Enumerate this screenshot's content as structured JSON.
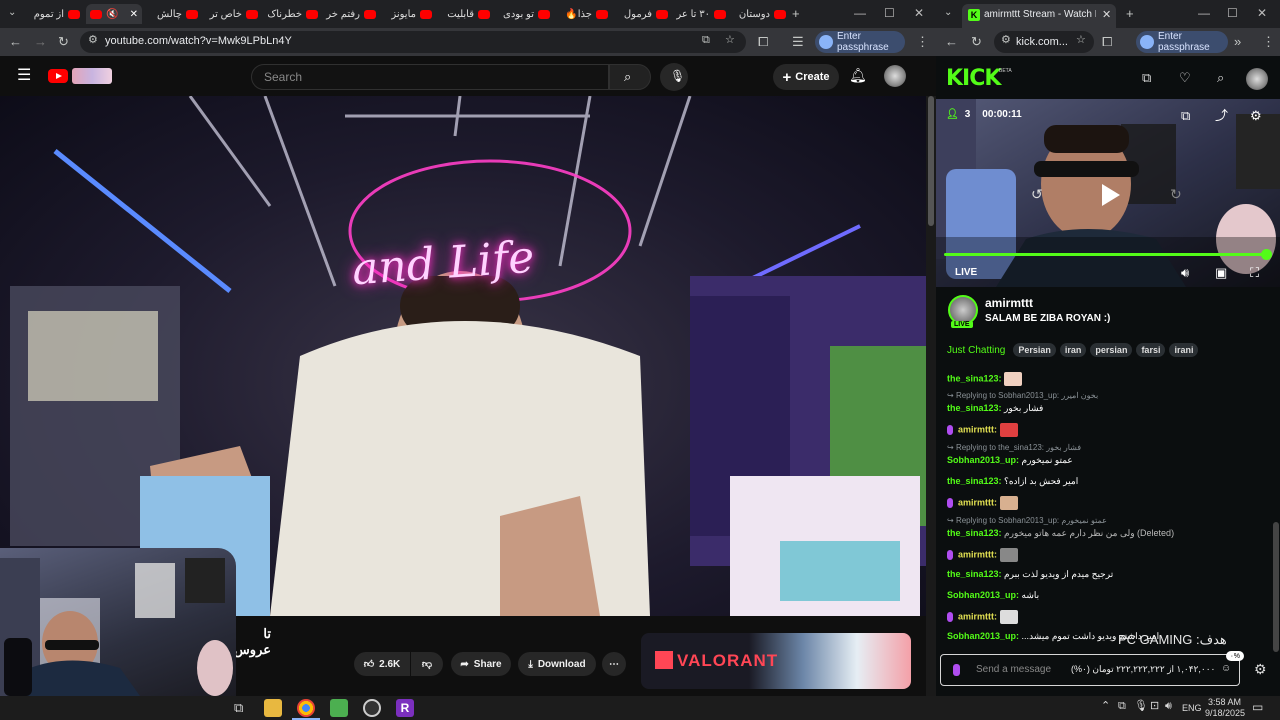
{
  "left_browser": {
    "tabs": [
      "دوستان",
      "۳۰ تا عر",
      "فرمول",
      "جذا🔥",
      "تو بودی",
      "قابلیت",
      "مایونز",
      "رفتم خر",
      "خطرناک",
      "خاص تر",
      "چالش",
      "",
      "از تموم"
    ],
    "url": "youtube.com/watch?v=Mwk9LPbLn4Y",
    "passphrase_label": "Enter passphrase"
  },
  "youtube": {
    "search_placeholder": "Search",
    "create_label": "Create",
    "video_title": "تا عروس",
    "like_count": "2.6K",
    "share_label": "Share",
    "download_label": "Download",
    "ad_brand": "VALORANT"
  },
  "video_overlay": {
    "neon_sign": "and Life"
  },
  "right_browser": {
    "tab_title": "amirmttt Stream - Watch Live o",
    "url": "kick.com...",
    "passphrase_label": "Enter passphrase"
  },
  "kick": {
    "logo": "KICK",
    "logo_badge": "BETA",
    "viewers": "3",
    "uptime": "00:00:11",
    "live_label": "LIVE",
    "streamer": "amirmttt",
    "stream_title": "SALAM BE ZIBA ROYAN :)",
    "category": "Just Chatting",
    "tags": [
      "Persian",
      "iran",
      "persian",
      "farsi",
      "irani"
    ],
    "chat": [
      {
        "user": "the_sina123",
        "text": ""
      },
      {
        "reply": "Replying to Sobhan2013_up: بخون امیرر"
      },
      {
        "user": "the_sina123",
        "text": "فشار بخور"
      },
      {
        "user": "amirmttt",
        "text": ""
      },
      {
        "reply": "Replying to the_sina123: فشار بخور"
      },
      {
        "user": "Sobhan2013_up",
        "text": "عمتو نمیخورم"
      },
      {
        "user": "the_sina123",
        "text": "امیر فحش بد ازاده؟"
      },
      {
        "user": "amirmttt",
        "text": ""
      },
      {
        "reply": "Replying to Sobhan2013_up: عمتو نمیخورم"
      },
      {
        "user": "the_sina123",
        "text": "ولی من نظر دارم عمه هاتو میخورم (Deleted)"
      },
      {
        "user": "amirmttt",
        "text": ""
      },
      {
        "user": "the_sina123",
        "text": "ترجیح میدم از ویدیو لذت ببرم"
      },
      {
        "user": "Sobhan2013_up",
        "text": "باشه"
      },
      {
        "user": "amirmttt",
        "text": ""
      },
      {
        "user": "Sobhan2013_up",
        "text": "...امیر داشتم ویدیو داشت تموم میشد"
      }
    ],
    "chat_placeholder": "Send a message",
    "goal_label": "هدف: PC GAMING",
    "goal_progress": "۱,۰۴۲,۰۰۰ از ۲۲۲,۲۲۲,۲۲۲ تومان (۰%)",
    "goal_percent": "۰%"
  },
  "taskbar": {
    "language": "ENG",
    "time": "3:58 AM",
    "date": "9/18/2025"
  },
  "colors": {
    "kick_green": "#53fc18",
    "youtube_red": "#ff0000",
    "chrome_dark": "#202124"
  }
}
